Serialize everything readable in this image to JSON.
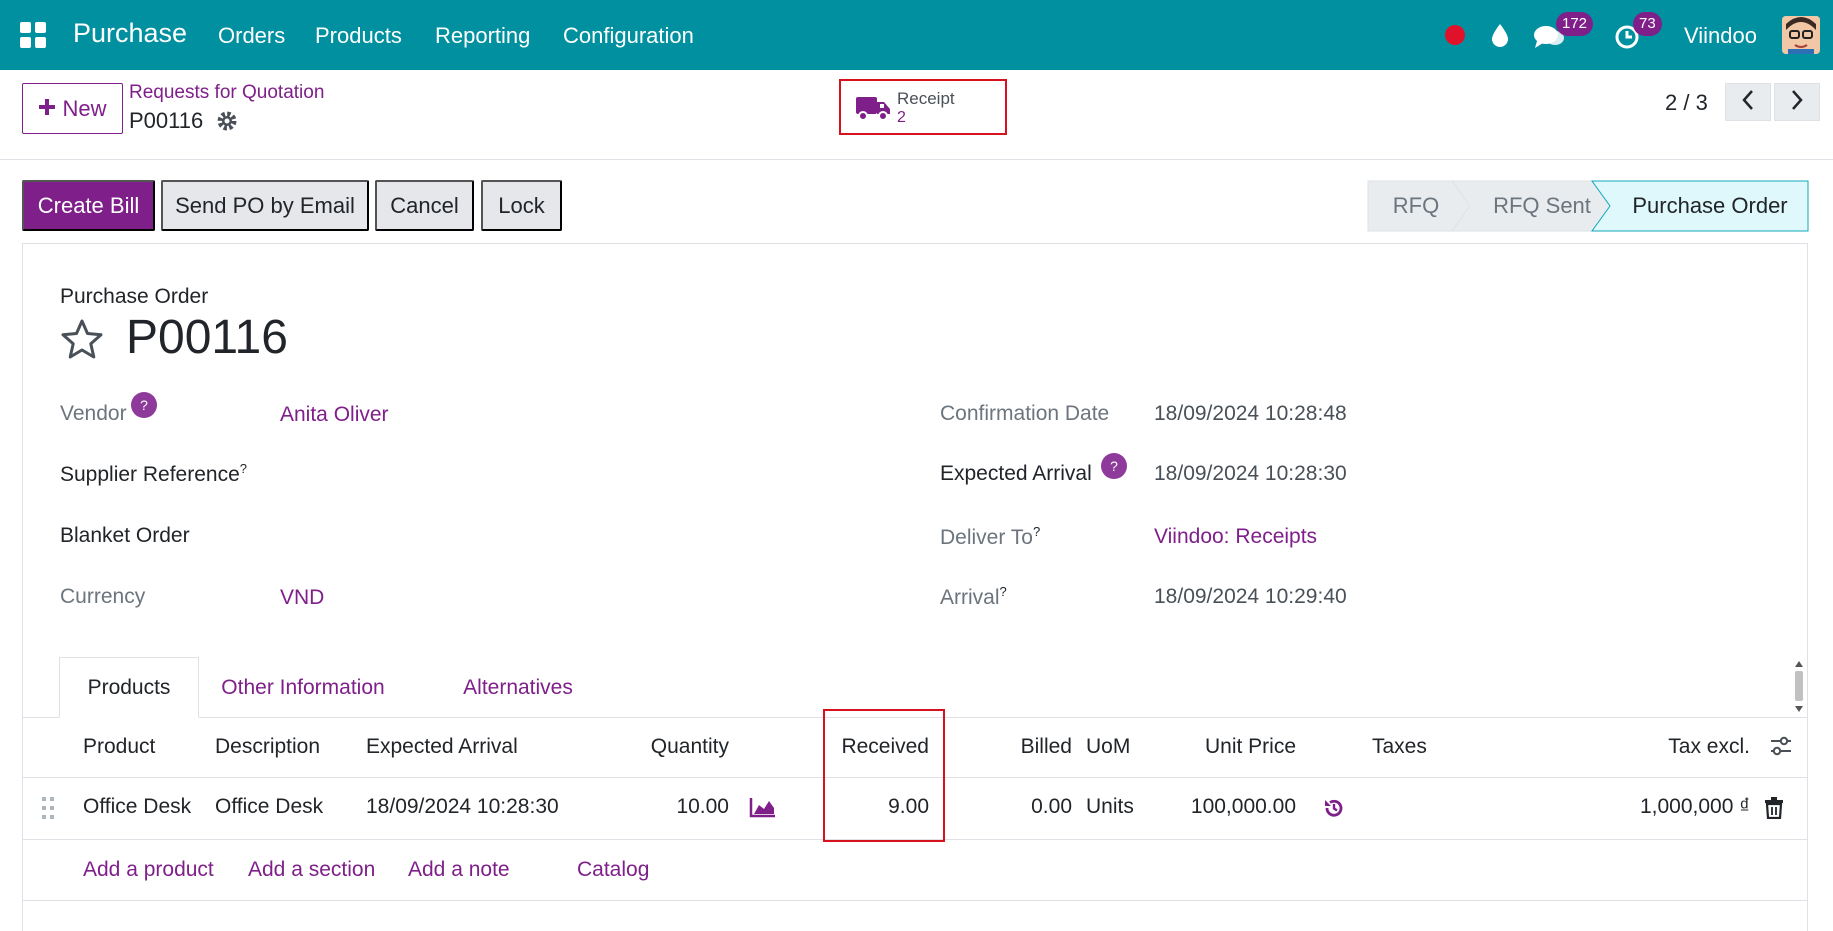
{
  "navbar": {
    "app_name": "Purchase",
    "menu": [
      "Orders",
      "Products",
      "Reporting",
      "Configuration"
    ],
    "messages_badge": "172",
    "activities_badge": "73",
    "user_name": "Viindoo"
  },
  "control_panel": {
    "new_label": "New",
    "breadcrumb_parent": "Requests for Quotation",
    "breadcrumb_current": "P00116",
    "smart_button": {
      "label": "Receipt",
      "count": "2"
    },
    "pager": "2 / 3"
  },
  "statusbar": {
    "buttons": [
      "Create Bill",
      "Send PO by Email",
      "Cancel",
      "Lock"
    ],
    "stages": [
      "RFQ",
      "RFQ Sent",
      "Purchase Order"
    ],
    "active_stage": "Purchase Order"
  },
  "form": {
    "type_label": "Purchase Order",
    "name": "P00116",
    "left_fields": [
      {
        "label": "Vendor",
        "value": "Anita Oliver"
      },
      {
        "label": "Supplier Reference",
        "value": ""
      },
      {
        "label": "Blanket Order",
        "value": ""
      },
      {
        "label": "Currency",
        "value": "VND"
      }
    ],
    "right_fields": [
      {
        "label": "Confirmation Date",
        "value": "18/09/2024 10:28:48"
      },
      {
        "label": "Expected Arrival",
        "value": "18/09/2024 10:28:30"
      },
      {
        "label": "Deliver To",
        "value": "Viindoo: Receipts"
      },
      {
        "label": "Arrival",
        "value": "18/09/2024 10:29:40"
      }
    ],
    "help_marker": "?",
    "tabs": [
      "Products",
      "Other Information",
      "Alternatives"
    ]
  },
  "order_lines": {
    "columns": [
      "Product",
      "Description",
      "Expected Arrival",
      "Quantity",
      "Received",
      "Billed",
      "UoM",
      "Unit Price",
      "Taxes",
      "Tax excl."
    ],
    "rows": [
      {
        "product": "Office Desk",
        "description": "Office Desk",
        "expected_arrival": "18/09/2024 10:28:30",
        "quantity": "10.00",
        "received": "9.00",
        "billed": "0.00",
        "uom": "Units",
        "unit_price": "100,000.00",
        "taxes": "",
        "subtotal": "1,000,000 ₫"
      }
    ],
    "add_links": [
      "Add a product",
      "Add a section",
      "Add a note",
      "Catalog"
    ]
  },
  "colors": {
    "navbar": "#01909f",
    "primary": "#7f1f8a",
    "highlight_box": "#d6121e",
    "active_stage": "#dff8fb"
  }
}
